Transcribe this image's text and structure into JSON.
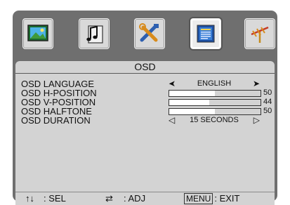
{
  "menu_icons": [
    {
      "name": "picture-icon",
      "selected": false
    },
    {
      "name": "music-note-icon",
      "selected": false
    },
    {
      "name": "tools-icon",
      "selected": false
    },
    {
      "name": "osd-panel-icon",
      "selected": true
    },
    {
      "name": "antenna-icon",
      "selected": false
    }
  ],
  "panel": {
    "title": "OSD",
    "rows": [
      {
        "label": "OSD LANGUAGE",
        "type": "option",
        "value": "ENGLISH"
      },
      {
        "label": "OSD H-POSITION",
        "type": "slider",
        "value": "50",
        "level": 0.5
      },
      {
        "label": "OSD V-POSITION",
        "type": "slider",
        "value": "44",
        "level": 0.44
      },
      {
        "label": "OSD HALFTONE",
        "type": "slider",
        "value": "50",
        "level": 0.5
      },
      {
        "label": "OSD DURATION",
        "type": "option",
        "value": "15 SECONDS"
      }
    ]
  },
  "footer": {
    "sel_icon": "up-down-arrows-icon",
    "sel_label": ": SEL",
    "adj_icon": "left-right-arrows-icon",
    "adj_label": ": ADJ",
    "menu_key": "MENU",
    "exit_label": ": EXIT"
  },
  "colors": {
    "frame": "#6f6f6f",
    "panel": "#d3d3d3",
    "bar_fill": "#ffffff"
  }
}
